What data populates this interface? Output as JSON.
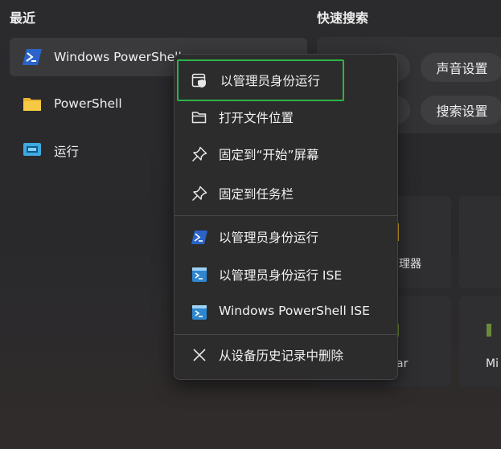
{
  "recent": {
    "title": "最近",
    "items": [
      {
        "label": "Windows PowerShell",
        "icon": "powershell-icon"
      },
      {
        "label": "PowerShell",
        "icon": "folder-icon"
      },
      {
        "label": "运行",
        "icon": "run-icon"
      }
    ]
  },
  "quick_search": {
    "title": "快速搜索",
    "chips": [
      {
        "label": "声音设置"
      },
      {
        "label": "搜索设置"
      }
    ],
    "tiles": [
      {
        "label": "理器"
      },
      {
        "label": "ar"
      },
      {
        "label": "Mi"
      }
    ]
  },
  "context_menu": {
    "items": [
      {
        "label": "以管理员身份运行",
        "icon": "shield-admin-icon"
      },
      {
        "label": "打开文件位置",
        "icon": "folder-open-icon"
      },
      {
        "label": "固定到“开始”屏幕",
        "icon": "pin-icon"
      },
      {
        "label": "固定到任务栏",
        "icon": "pin-icon"
      },
      {
        "label": "以管理员身份运行",
        "icon": "powershell-icon"
      },
      {
        "label": "以管理员身份运行 ISE",
        "icon": "powershell-ise-icon"
      },
      {
        "label": "Windows PowerShell ISE",
        "icon": "powershell-ise-icon"
      },
      {
        "label": "从设备历史记录中删除",
        "icon": "close-icon"
      }
    ]
  },
  "colors": {
    "highlight_border": "#2eb347",
    "powershell_blue": "#2a64c8",
    "folder_yellow": "#f3c43c",
    "run_cyan": "#3fa9e0"
  }
}
